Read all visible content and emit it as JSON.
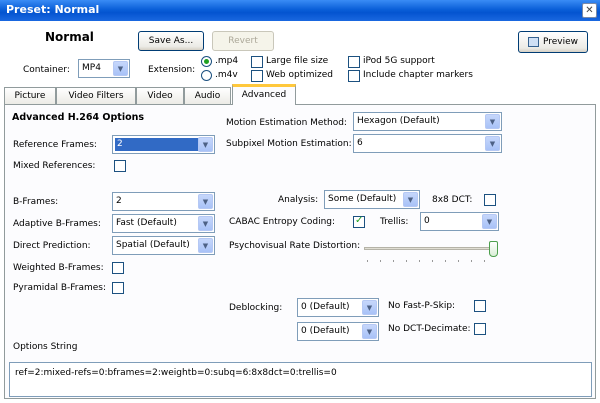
{
  "window": {
    "title": "Preset: Normal",
    "close_glyph": "✕"
  },
  "header": {
    "preset_name": "Normal",
    "save_as": "Save As...",
    "revert": "Revert",
    "preview": "Preview",
    "container_label": "Container:",
    "container_value": "MP4",
    "extension_label": "Extension:",
    "ext_mp4": ".mp4",
    "ext_m4v": ".m4v",
    "large_file": "Large file size",
    "web_optimized": "Web optimized",
    "ipod": "iPod 5G support",
    "chapters": "Include chapter markers"
  },
  "tabs": [
    "Picture",
    "Video Filters",
    "Video",
    "Audio",
    "Advanced"
  ],
  "advanced": {
    "section_title": "Advanced H.264 Options",
    "ref_frames_label": "Reference Frames:",
    "ref_frames_value": "2",
    "mixed_refs_label": "Mixed References:",
    "motion_est_label": "Motion Estimation Method:",
    "motion_est_value": "Hexagon (Default)",
    "subpixel_label": "Subpixel Motion Estimation:",
    "subpixel_value": "6",
    "bframes_label": "B-Frames:",
    "bframes_value": "2",
    "adaptive_label": "Adaptive B-Frames:",
    "adaptive_value": "Fast (Default)",
    "direct_label": "Direct Prediction:",
    "direct_value": "Spatial (Default)",
    "weighted_label": "Weighted B-Frames:",
    "pyramidal_label": "Pyramidal B-Frames:",
    "analysis_label": "Analysis:",
    "analysis_value": "Some (Default)",
    "dct8_label": "8x8 DCT:",
    "cabac_label": "CABAC Entropy Coding:",
    "trellis_label": "Trellis:",
    "trellis_value": "0",
    "psy_label": "Psychovisual Rate Distortion:",
    "deblock_label": "Deblocking:",
    "deblock_value1": "0 (Default)",
    "deblock_value2": "0 (Default)",
    "fastpskip_label": "No Fast-P-Skip:",
    "dctdecimate_label": "No DCT-Decimate:",
    "options_label": "Options String",
    "options_string": "ref=2:mixed-refs=0:bframes=2:weightb=0:subq=6:8x8dct=0:trellis=0"
  },
  "psy_slider_value": 1.0,
  "dropdown_arrow": "▼"
}
